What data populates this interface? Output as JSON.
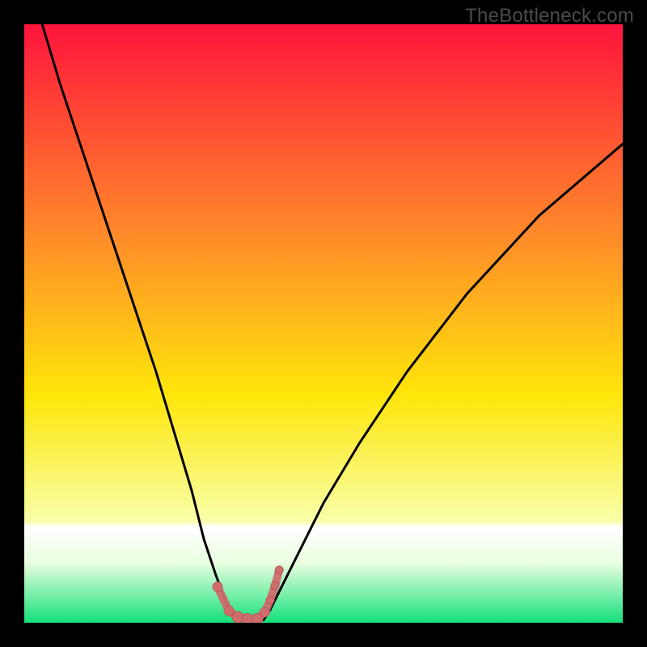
{
  "watermark": "TheBottleneck.com",
  "colors": {
    "frame": "#000000",
    "grad_top": "#ff143c",
    "grad_mid1": "#ff8a2a",
    "grad_mid2": "#ffe60a",
    "grad_low": "#f8ffa8",
    "grad_bottom": "#13e07a",
    "curve": "#000000",
    "marker_fill": "#cf6d6d",
    "marker_stroke": "#b85a5a"
  },
  "chart_data": {
    "type": "line",
    "title": "",
    "xlabel": "",
    "ylabel": "",
    "xlim": [
      0,
      100
    ],
    "ylim": [
      0,
      100
    ],
    "series": [
      {
        "name": "left-curve",
        "x": [
          3,
          6,
          10,
          14,
          18,
          22,
          25,
          28,
          30,
          32,
          33.5,
          34.5,
          35.2
        ],
        "y": [
          100,
          90,
          78,
          66,
          54,
          42,
          32,
          22,
          14,
          8,
          4,
          1.5,
          0.5
        ]
      },
      {
        "name": "right-curve",
        "x": [
          40,
          41,
          43,
          46,
          50,
          56,
          64,
          74,
          86,
          100
        ],
        "y": [
          0.5,
          2,
          6,
          12,
          20,
          30,
          42,
          55,
          68,
          80
        ]
      },
      {
        "name": "valley-floor",
        "x": [
          35.2,
          36,
          37,
          38,
          39,
          40
        ],
        "y": [
          0.5,
          0.3,
          0.25,
          0.25,
          0.3,
          0.5
        ]
      }
    ],
    "markers": {
      "name": "valley-points",
      "x": [
        32.3,
        34.2,
        35.7,
        37.3,
        38.9,
        40.2,
        41.1,
        41.9,
        42.6
      ],
      "y": [
        6.0,
        2.0,
        0.9,
        0.6,
        0.6,
        1.8,
        3.8,
        6.2,
        8.8
      ],
      "r": [
        6,
        6,
        7,
        7,
        7,
        6,
        5,
        5,
        5
      ]
    }
  }
}
